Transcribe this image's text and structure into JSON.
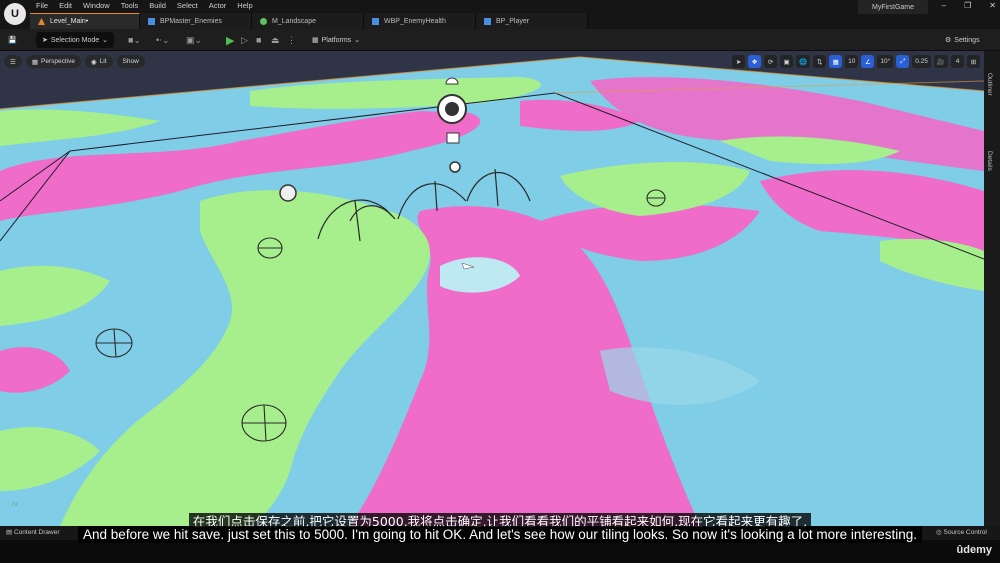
{
  "menu": [
    "File",
    "Edit",
    "Window",
    "Tools",
    "Build",
    "Select",
    "Actor",
    "Help"
  ],
  "tabs": [
    {
      "label": "Level_Main•",
      "icon": "level-icon"
    },
    {
      "label": "BPMaster_Enemies",
      "icon": "blueprint-icon"
    },
    {
      "label": "M_Landscape",
      "icon": "material-icon"
    },
    {
      "label": "WBP_EnemyHealth",
      "icon": "widget-icon"
    },
    {
      "label": "BP_Player",
      "icon": "blueprint-icon"
    }
  ],
  "project_name": "MyFirstGame",
  "toolbar": {
    "selection_mode": "Selection Mode",
    "platforms": "Platforms",
    "settings": "Settings"
  },
  "viewport": {
    "perspective": "Perspective",
    "lit": "Lit",
    "show": "Show",
    "grid_size": "10",
    "rotation_snap": "10°",
    "scale_snap": "0.25",
    "camera_speed": "4"
  },
  "side_panels": [
    "Outliner",
    "Details"
  ],
  "bottom": {
    "content_drawer": "Content Drawer",
    "source_control": "Source Control"
  },
  "subtitles": {
    "zh": "在我们点击保存之前,把它设置为5000,我将点击确定,让我们看看我们的平铺看起来如何,现在它看起来更有趣了,",
    "en": "And before we hit save. just set this to 5000. I'm going to hit OK. And let's see how our tiling looks. So now it's looking a lot more interesting."
  },
  "watermark": "ûdemy",
  "colors": {
    "accent": "#e08a2c",
    "pink": "#f06ac8",
    "green": "#a6ef8c",
    "cyan": "#79d2e8",
    "active_blue": "#2a5fd6"
  }
}
